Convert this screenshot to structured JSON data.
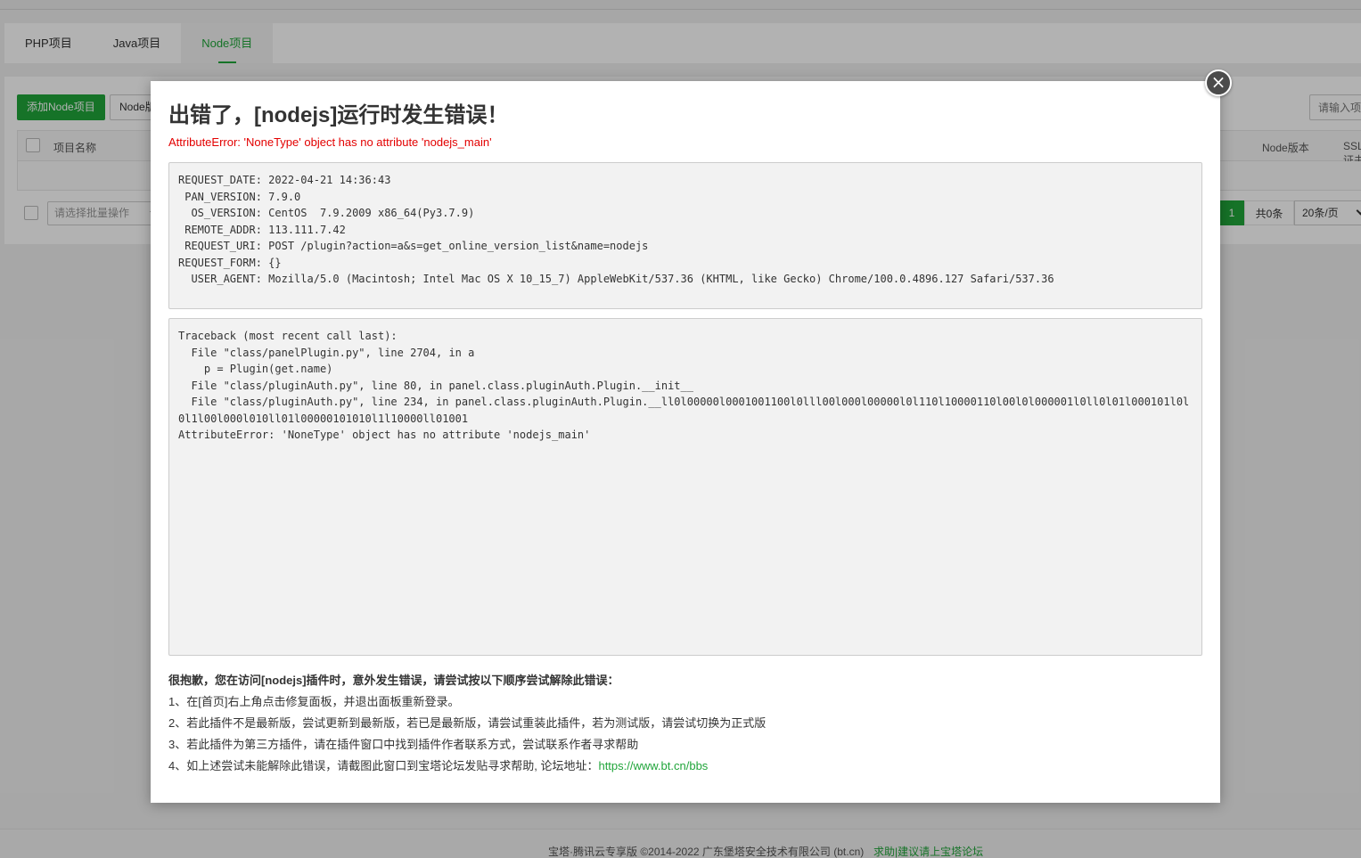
{
  "tabs": [
    {
      "label": "PHP项目"
    },
    {
      "label": "Java项目"
    },
    {
      "label": "Node项目"
    }
  ],
  "toolbar": {
    "add_label": "添加Node项目",
    "node_label": "Node版本管理器",
    "search_placeholder": "请输入项目名称"
  },
  "table": {
    "headers": {
      "name": "项目名称",
      "node_version": "Node版本",
      "ssl": "SSL证书"
    }
  },
  "batch": {
    "placeholder": "请选择批量操作"
  },
  "pager": {
    "current": "1",
    "total": "共0条",
    "size": "20条/页"
  },
  "footer": {
    "copyright": "宝塔·腾讯云专享版 ©2014-2022 广东堡塔安全技术有限公司 (bt.cn)",
    "link": "求助|建议请上宝塔论坛"
  },
  "modal": {
    "close": "×",
    "title": "出错了，[nodejs]运行时发生错误！",
    "error": "AttributeError: 'NoneType' object has no attribute 'nodejs_main'",
    "info_text": "REQUEST_DATE: 2022-04-21 14:36:43\n PAN_VERSION: 7.9.0\n  OS_VERSION: CentOS  7.9.2009 x86_64(Py3.7.9)\n REMOTE_ADDR: 113.111.7.42\n REQUEST_URI: POST /plugin?action=a&s=get_online_version_list&name=nodejs\nREQUEST_FORM: {}\n  USER_AGENT: Mozilla/5.0 (Macintosh; Intel Mac OS X 10_15_7) AppleWebKit/537.36 (KHTML, like Gecko) Chrome/100.0.4896.127 Safari/537.36",
    "traceback": "Traceback (most recent call last):\n  File \"class/panelPlugin.py\", line 2704, in a\n    p = Plugin(get.name)\n  File \"class/pluginAuth.py\", line 80, in panel.class.pluginAuth.Plugin.__init__\n  File \"class/pluginAuth.py\", line 234, in panel.class.pluginAuth.Plugin.__ll0l00000l0001001100l0lll00l000l00000l0l110l10000110l00l0l000001l0ll0l01l000101l0l0l1l00l000l010ll01l00000101010l1l10000ll01001\nAttributeError: 'NoneType' object has no attribute 'nodejs_main'",
    "help": {
      "title": "很抱歉，您在访问[nodejs]插件时，意外发生错误，请尝试按以下顺序尝试解除此错误：",
      "step1": "1、在[首页]右上角点击修复面板，并退出面板重新登录。",
      "step2": "2、若此插件不是最新版，尝试更新到最新版，若已是最新版，请尝试重装此插件，若为测试版，请尝试切换为正式版",
      "step3": "3、若此插件为第三方插件，请在插件窗口中找到插件作者联系方式，尝试联系作者寻求帮助",
      "step4": "4、如上述尝试未能解除此错误，请截图此窗口到宝塔论坛发贴寻求帮助, 论坛地址：",
      "link": "https://www.bt.cn/bbs"
    }
  }
}
